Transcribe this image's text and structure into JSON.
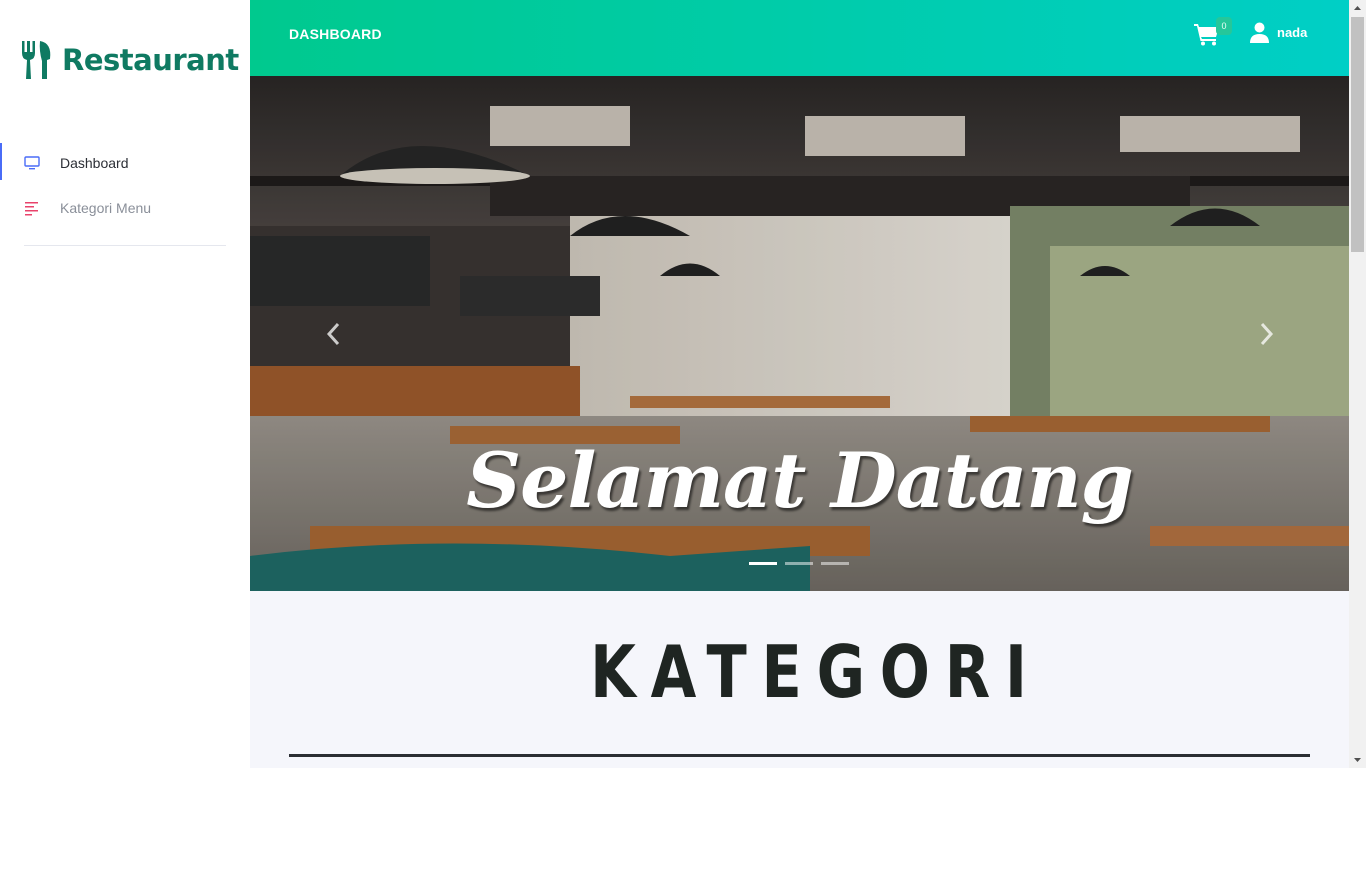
{
  "brand": {
    "name": "Restaurant",
    "icon": "fork-knife-icon",
    "color": "#0f7a62"
  },
  "sidebar": {
    "items": [
      {
        "label": "Dashboard",
        "icon": "monitor-icon",
        "active": true
      },
      {
        "label": "Kategori Menu",
        "icon": "menu-lines-icon",
        "active": false
      }
    ]
  },
  "topbar": {
    "title": "DASHBOARD",
    "cart_count": "0",
    "user_name": "nada",
    "gradient": [
      "#00c98e",
      "#00cfc6"
    ]
  },
  "carousel": {
    "caption": "Selamat Datang",
    "slide_count": 3,
    "active_index": 0
  },
  "section": {
    "title": "KATEGORI"
  }
}
